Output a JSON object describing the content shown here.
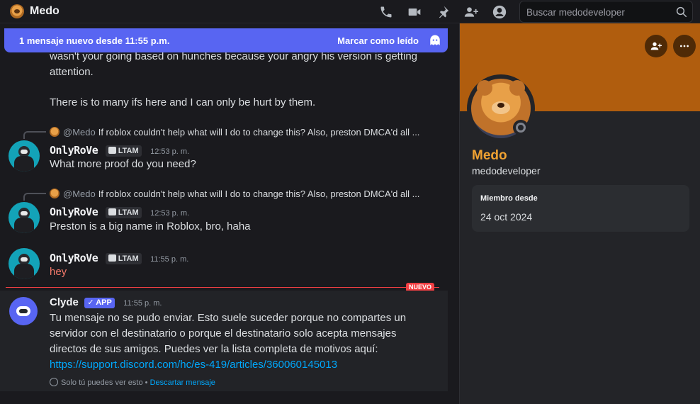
{
  "header": {
    "title": "Medo",
    "search_placeholder": "Buscar medodeveloper",
    "icons": [
      "call-icon",
      "video-icon",
      "pin-icon",
      "add-friend-icon",
      "user-profile-icon",
      "search-icon"
    ]
  },
  "new_banner": {
    "text": "1 mensaje nuevo desde 11:55 p.m.",
    "mark_read": "Marcar como leído"
  },
  "chat": {
    "prev_lines": [
      "wasn't your going based on hunches because your angry his version is getting",
      "attention.",
      "There is to many ifs here and I can only be hurt by them."
    ],
    "messages": [
      {
        "reply_name": "@Medo",
        "reply_text": "If roblox couldn't help what will I do to change this? Also, preston DMCA'd all ...",
        "author": "OnlyRoVe",
        "tag": "LTAM",
        "time": "12:53 p. m.",
        "text": "What more proof do you need?"
      },
      {
        "reply_name": "@Medo",
        "reply_text": "If roblox couldn't help what will I do to change this? Also, preston DMCA'd all ...",
        "author": "OnlyRoVe",
        "tag": "LTAM",
        "time": "12:53 p. m.",
        "text": "Preston is a big name in Roblox, bro, haha"
      },
      {
        "author": "OnlyRoVe",
        "tag": "LTAM",
        "time": "11:55 p. m.",
        "text": "hey"
      }
    ],
    "new_label": "NUEVO",
    "clyde": {
      "author": "Clyde",
      "app_tag": "APP",
      "time": "11:55 p. m.",
      "text": "Tu mensaje no se pudo enviar. Esto suele suceder porque no compartes un servidor con el destinatario o porque el destinatario solo acepta mensajes directos de sus amigos. Puedes ver la lista completa de motivos aquí:",
      "link": "https://support.discord.com/hc/es-419/articles/360060145013",
      "only_you": "Solo tú puedes ver esto",
      "separator": "•",
      "dismiss": "Descartar mensaje"
    }
  },
  "profile": {
    "display_name": "Medo",
    "username": "medodeveloper",
    "member_since_label": "Miembro desde",
    "member_since_value": "24 oct 2024"
  },
  "colors": {
    "accent": "#5865f2",
    "banner": "#b05d0e",
    "name": "#f0a232",
    "divider": "#f23f43",
    "link": "#00a8fc"
  }
}
